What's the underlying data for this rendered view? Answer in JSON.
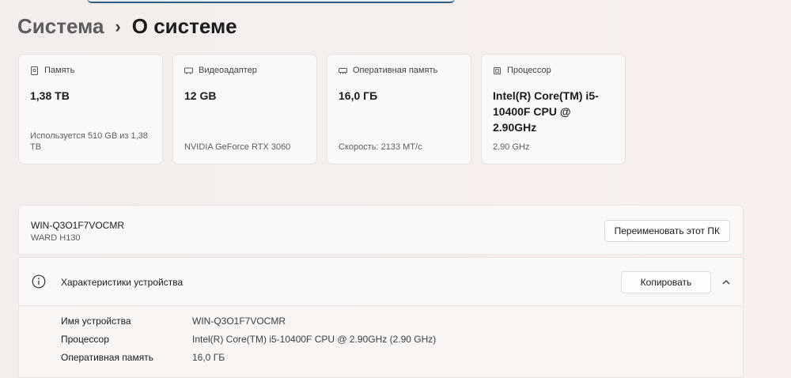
{
  "breadcrumb": {
    "parent": "Система",
    "separator": "›",
    "current": "О системе"
  },
  "cards": [
    {
      "icon": "storage-icon",
      "title": "Память",
      "value": "1,38 TB",
      "sub": "Используется 510 GB из 1,38 TB"
    },
    {
      "icon": "gpu-icon",
      "title": "Видеоадаптер",
      "value": "12 GB",
      "sub": "NVIDIA GeForce RTX 3060"
    },
    {
      "icon": "ram-icon",
      "title": "Оперативная память",
      "value": "16,0 ГБ",
      "sub": "Скорость: 2133 МТ/с"
    },
    {
      "icon": "cpu-icon",
      "title": "Процессор",
      "value": "Intel(R) Core(TM) i5-10400F CPU @ 2.90GHz",
      "sub": "2.90 GHz"
    }
  ],
  "device": {
    "name": "WIN-Q3O1F7VOCMR",
    "model": "WARD H130",
    "rename_label": "Переименовать этот ПК"
  },
  "specs": {
    "title": "Характеристики устройства",
    "copy_label": "Копировать",
    "rows": [
      {
        "label": "Имя устройства",
        "value": "WIN-Q3O1F7VOCMR"
      },
      {
        "label": "Процессор",
        "value": "Intel(R) Core(TM) i5-10400F CPU @ 2.90GHz (2.90 GHz)"
      },
      {
        "label": "Оперативная память",
        "value": "16,0 ГБ"
      }
    ]
  }
}
